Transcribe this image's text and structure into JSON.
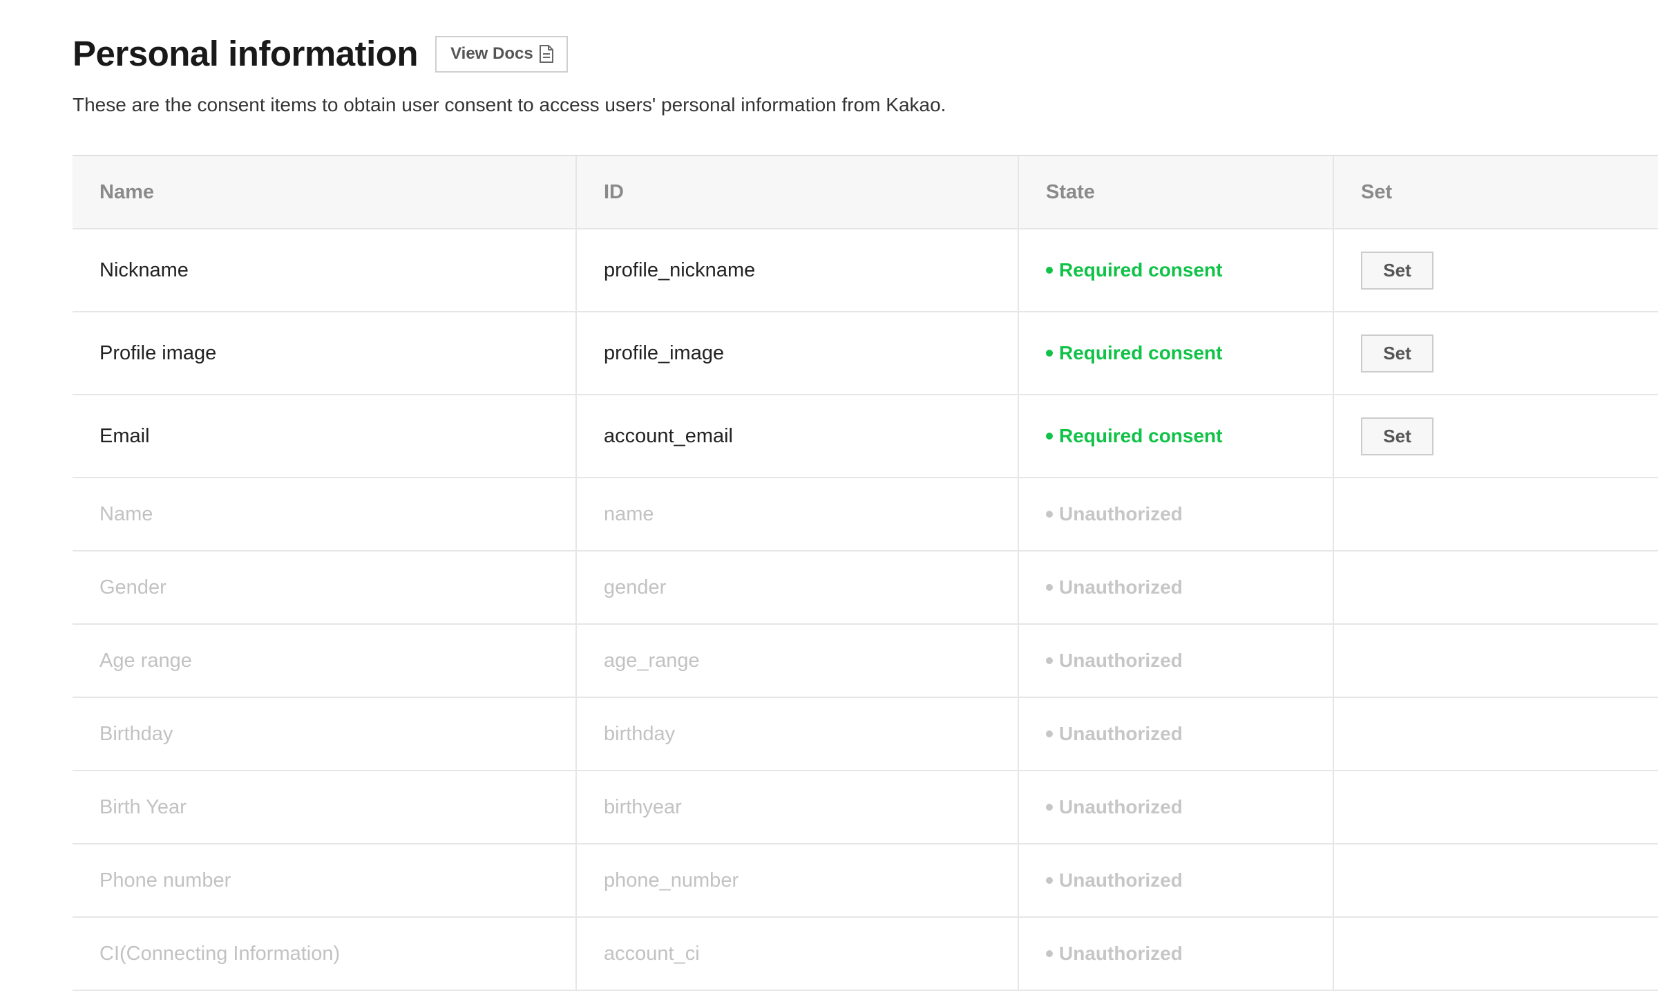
{
  "header": {
    "title": "Personal information",
    "docs_button_label": "View Docs",
    "description": "These are the consent items to obtain user consent to access users' personal information from Kakao."
  },
  "table": {
    "columns": {
      "name": "Name",
      "id": "ID",
      "state": "State",
      "set": "Set"
    },
    "rows": [
      {
        "name": "Nickname",
        "id": "profile_nickname",
        "state": "Required consent",
        "set_label": "Set"
      },
      {
        "name": "Profile image",
        "id": "profile_image",
        "state": "Required consent",
        "set_label": "Set"
      },
      {
        "name": "Email",
        "id": "account_email",
        "state": "Required consent",
        "set_label": "Set"
      },
      {
        "name": "Name",
        "id": "name",
        "state": "Unauthorized"
      },
      {
        "name": "Gender",
        "id": "gender",
        "state": "Unauthorized"
      },
      {
        "name": "Age range",
        "id": "age_range",
        "state": "Unauthorized"
      },
      {
        "name": "Birthday",
        "id": "birthday",
        "state": "Unauthorized"
      },
      {
        "name": "Birth Year",
        "id": "birthyear",
        "state": "Unauthorized"
      },
      {
        "name": "Phone number",
        "id": "phone_number",
        "state": "Unauthorized"
      },
      {
        "name": "CI(Connecting Information)",
        "id": "account_ci",
        "state": "Unauthorized"
      }
    ]
  },
  "colors": {
    "required_consent": "#10c247",
    "unauthorized": "#c6c6c6",
    "header_bg": "#f7f7f7"
  },
  "icons": {
    "docs_button": "document-icon",
    "state_indicator": "status-dot"
  }
}
